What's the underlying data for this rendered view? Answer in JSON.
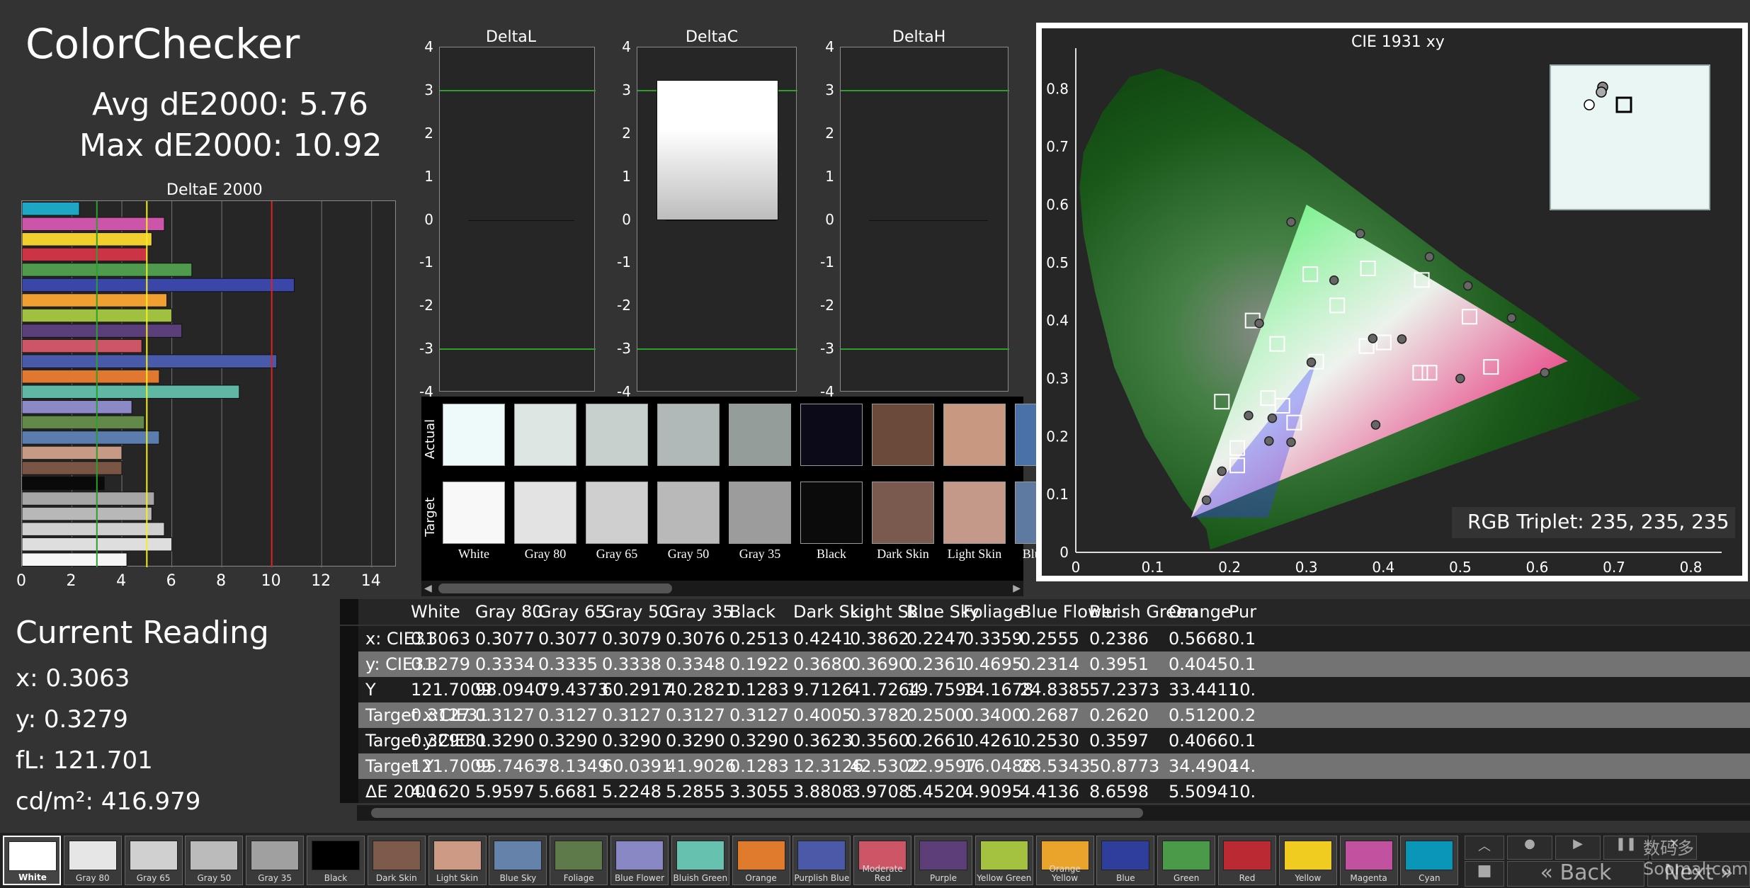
{
  "title": "ColorChecker",
  "avg_de": "Avg dE2000: 5.76",
  "max_de": "Max dE2000: 10.92",
  "deltae_chart": {
    "title": "DeltaE 2000",
    "xticks": [
      "0",
      "2",
      "4",
      "6",
      "8",
      "10",
      "12",
      "14"
    ],
    "xlim": [
      0,
      15
    ],
    "bars": [
      {
        "value": 2.3,
        "color": "#1ea7c5"
      },
      {
        "value": 5.7,
        "color": "#cc55aa"
      },
      {
        "value": 5.2,
        "color": "#f2cf2c"
      },
      {
        "value": 5.0,
        "color": "#cc3344"
      },
      {
        "value": 6.8,
        "color": "#4f9a4c"
      },
      {
        "value": 10.9,
        "color": "#3a47a8"
      },
      {
        "value": 5.8,
        "color": "#f0a030"
      },
      {
        "value": 6.0,
        "color": "#a0c040"
      },
      {
        "value": 6.4,
        "color": "#5a3f7a"
      },
      {
        "value": 4.8,
        "color": "#cc5566"
      },
      {
        "value": 10.2,
        "color": "#4a5aaa"
      },
      {
        "value": 5.5,
        "color": "#e07830"
      },
      {
        "value": 8.7,
        "color": "#5fb8a4"
      },
      {
        "value": 4.4,
        "color": "#8c8ac6"
      },
      {
        "value": 4.9,
        "color": "#62894a"
      },
      {
        "value": 5.5,
        "color": "#5a7cae"
      },
      {
        "value": 4.0,
        "color": "#c79a85"
      },
      {
        "value": 4.0,
        "color": "#7a5444"
      },
      {
        "value": 3.3,
        "color": "#0a0a0a"
      },
      {
        "value": 5.3,
        "color": "#a6a6a6"
      },
      {
        "value": 5.2,
        "color": "#b8b8b8"
      },
      {
        "value": 5.7,
        "color": "#d0d0d0"
      },
      {
        "value": 6.0,
        "color": "#dedede"
      },
      {
        "value": 4.2,
        "color": "#f6f6f6"
      }
    ],
    "thresholds": [
      {
        "value": 3,
        "color": "#2ba02b"
      },
      {
        "value": 5,
        "color": "#f2f020"
      },
      {
        "value": 10,
        "color": "#dd2222"
      }
    ]
  },
  "delta_charts": [
    {
      "title": "DeltaL",
      "value": 0.0
    },
    {
      "title": "DeltaC",
      "value": 3.25
    },
    {
      "title": "DeltaH",
      "value": 0.0
    }
  ],
  "delta_yticks": [
    "4",
    "3",
    "2",
    "1",
    "0",
    "-1",
    "-2",
    "-3",
    "-4"
  ],
  "swatch_rows": {
    "actual": "Actual",
    "target": "Target"
  },
  "swatches": [
    {
      "label": "White",
      "actual": "#eefafa",
      "target": "#f8f8f8"
    },
    {
      "label": "Gray 80",
      "actual": "#dde6e3",
      "target": "#e3e3e3"
    },
    {
      "label": "Gray 65",
      "actual": "#c6d1ce",
      "target": "#cfcfcf"
    },
    {
      "label": "Gray 50",
      "actual": "#b0b9b7",
      "target": "#b9b9b9"
    },
    {
      "label": "Gray 35",
      "actual": "#959d9b",
      "target": "#9c9c9c"
    },
    {
      "label": "Black",
      "actual": "#0c0a18",
      "target": "#0b0b0b"
    },
    {
      "label": "Dark Skin",
      "actual": "#6b4a3a",
      "target": "#7a5a4f"
    },
    {
      "label": "Light Skin",
      "actual": "#c99880",
      "target": "#c5998a"
    },
    {
      "label": "Blue Sky",
      "actual": "#4a72a8",
      "target": "#5e7aa0"
    }
  ],
  "cie": {
    "title": "CIE 1931 xy",
    "xticks": [
      "0",
      "0.1",
      "0.2",
      "0.3",
      "0.4",
      "0.5",
      "0.6",
      "0.7",
      "0.8"
    ],
    "yticks": [
      "0.8",
      "0.7",
      "0.6",
      "0.5",
      "0.4",
      "0.3",
      "0.2",
      "0.1",
      "0"
    ],
    "gamut": [
      [
        0.64,
        0.33
      ],
      [
        0.3,
        0.6
      ],
      [
        0.15,
        0.06
      ]
    ],
    "targets": [
      [
        0.3127,
        0.329
      ],
      [
        0.4005,
        0.3623
      ],
      [
        0.3782,
        0.356
      ],
      [
        0.25,
        0.2661
      ],
      [
        0.34,
        0.4261
      ],
      [
        0.2687,
        0.253
      ],
      [
        0.262,
        0.3597
      ],
      [
        0.512,
        0.4066
      ],
      [
        0.21,
        0.18
      ],
      [
        0.46,
        0.31
      ],
      [
        0.284,
        0.224
      ],
      [
        0.38,
        0.49
      ],
      [
        0.23,
        0.4
      ],
      [
        0.45,
        0.47
      ],
      [
        0.54,
        0.32
      ],
      [
        0.19,
        0.26
      ],
      [
        0.305,
        0.48
      ],
      [
        0.448,
        0.31
      ],
      [
        0.21,
        0.15
      ]
    ],
    "actuals": [
      [
        0.3063,
        0.3279
      ],
      [
        0.4241,
        0.368
      ],
      [
        0.3862,
        0.369
      ],
      [
        0.2247,
        0.2361
      ],
      [
        0.3359,
        0.4695
      ],
      [
        0.2555,
        0.2314
      ],
      [
        0.2386,
        0.3951
      ],
      [
        0.5668,
        0.4045
      ],
      [
        0.19,
        0.14
      ],
      [
        0.5,
        0.3
      ],
      [
        0.28,
        0.19
      ],
      [
        0.37,
        0.55
      ],
      [
        0.28,
        0.57
      ],
      [
        0.46,
        0.51
      ],
      [
        0.61,
        0.31
      ],
      [
        0.17,
        0.09
      ],
      [
        0.51,
        0.46
      ],
      [
        0.39,
        0.22
      ],
      [
        0.2513,
        0.1922
      ]
    ],
    "rgb_triplet": "RGB Triplet: 235, 235, 235"
  },
  "current_reading": {
    "title": "Current Reading",
    "x": "x: 0.3063",
    "y": "y: 0.3279",
    "fl": "fL: 121.701",
    "cd": "cd/m²: 416.979"
  },
  "table": {
    "columns": [
      "White",
      "Gray 80",
      "Gray 65",
      "Gray 50",
      "Gray 35",
      "Black",
      "Dark Skin",
      "Light Skin",
      "Blue Sky",
      "Foliage",
      "Blue Flower",
      "Bluish Green",
      "Orange",
      "Pur"
    ],
    "rows": [
      {
        "label": "x: CIE31",
        "values": [
          "0.3063",
          "0.3077",
          "0.3077",
          "0.3079",
          "0.3076",
          "0.2513",
          "0.4241",
          "0.3862",
          "0.2247",
          "0.3359",
          "0.2555",
          "0.2386",
          "0.5668",
          "0.1"
        ]
      },
      {
        "label": "y: CIE31",
        "values": [
          "0.3279",
          "0.3334",
          "0.3335",
          "0.3338",
          "0.3348",
          "0.1922",
          "0.3680",
          "0.3690",
          "0.2361",
          "0.4695",
          "0.2314",
          "0.3951",
          "0.4045",
          "0.1"
        ]
      },
      {
        "label": "Y",
        "values": [
          "121.7009",
          "98.0940",
          "79.4373",
          "60.2917",
          "40.2821",
          "0.1283",
          "9.7126",
          "41.7264",
          "19.7598",
          "14.1678",
          "24.8385",
          "57.2373",
          "33.4411",
          "10."
        ]
      },
      {
        "label": "Target x:CIE31",
        "values": [
          "0.3127",
          "0.3127",
          "0.3127",
          "0.3127",
          "0.3127",
          "0.3127",
          "0.4005",
          "0.3782",
          "0.2500",
          "0.3400",
          "0.2687",
          "0.2620",
          "0.5120",
          "0.2"
        ]
      },
      {
        "label": "Target y:CIE31",
        "values": [
          "0.3290",
          "0.3290",
          "0.3290",
          "0.3290",
          "0.3290",
          "0.3290",
          "0.3623",
          "0.3560",
          "0.2661",
          "0.4261",
          "0.2530",
          "0.3597",
          "0.4066",
          "0.1"
        ]
      },
      {
        "label": "Target Y",
        "values": [
          "121.7009",
          "95.7463",
          "78.1349",
          "60.0391",
          "41.9026",
          "0.1283",
          "12.3126",
          "42.5302",
          "22.9597",
          "16.0486",
          "28.5343",
          "50.8773",
          "34.4904",
          "14."
        ]
      },
      {
        "label": "ΔE 2000",
        "values": [
          "4.1620",
          "5.9597",
          "5.6681",
          "5.2248",
          "5.2855",
          "3.3055",
          "3.8808",
          "3.9708",
          "5.4520",
          "4.9095",
          "4.4136",
          "8.6598",
          "5.5094",
          "10."
        ]
      }
    ]
  },
  "chips": [
    {
      "label": "White",
      "color": "#ffffff"
    },
    {
      "label": "Gray 80",
      "color": "#e6e6e6"
    },
    {
      "label": "Gray 65",
      "color": "#d0d0d0"
    },
    {
      "label": "Gray 50",
      "color": "#bbbbbb"
    },
    {
      "label": "Gray 35",
      "color": "#a0a0a0"
    },
    {
      "label": "Black",
      "color": "#000000"
    },
    {
      "label": "Dark Skin",
      "color": "#7e5a4a"
    },
    {
      "label": "Light Skin",
      "color": "#cc9a85"
    },
    {
      "label": "Blue Sky",
      "color": "#6482aa"
    },
    {
      "label": "Foliage",
      "color": "#5e7a4a"
    },
    {
      "label": "Blue Flower",
      "color": "#8a88c4"
    },
    {
      "label": "Bluish Green",
      "color": "#66c2ae"
    },
    {
      "label": "Orange",
      "color": "#e07a2c"
    },
    {
      "label": "Purplish Blue",
      "color": "#4a5aa8"
    },
    {
      "label": "Moderate Red",
      "color": "#cc5566"
    },
    {
      "label": "Purple",
      "color": "#5e3e78"
    },
    {
      "label": "Yellow Green",
      "color": "#a4c240"
    },
    {
      "label": "Orange Yellow",
      "color": "#eaa42c"
    },
    {
      "label": "Blue",
      "color": "#2e3e9a"
    },
    {
      "label": "Green",
      "color": "#4a9a4a"
    },
    {
      "label": "Red",
      "color": "#bb2a33"
    },
    {
      "label": "Yellow",
      "color": "#f0cc20"
    },
    {
      "label": "Magenta",
      "color": "#c052a0"
    },
    {
      "label": "Cyan",
      "color": "#0a96b8"
    }
  ],
  "nav": {
    "back": "Back",
    "next": "Next"
  },
  "watermark": "数码多 Soomal.com"
}
